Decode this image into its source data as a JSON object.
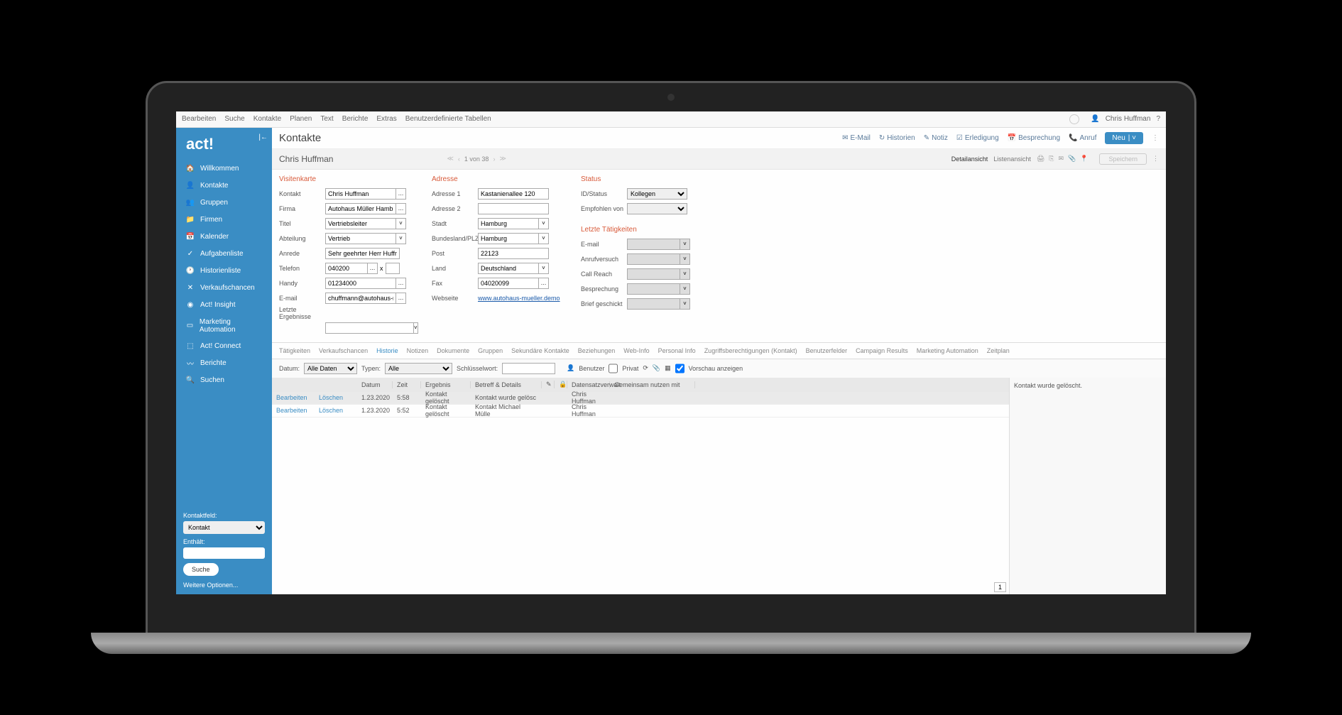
{
  "topmenu": [
    "Bearbeiten",
    "Suche",
    "Kontakte",
    "Planen",
    "Text",
    "Berichte",
    "Extras",
    "Benutzerdefinierte Tabellen"
  ],
  "user": "Chris Huffman",
  "logo": "act!",
  "nav": [
    {
      "icon": "🏠",
      "label": "Willkommen"
    },
    {
      "icon": "👤",
      "label": "Kontakte"
    },
    {
      "icon": "👥",
      "label": "Gruppen"
    },
    {
      "icon": "📁",
      "label": "Firmen"
    },
    {
      "icon": "📅",
      "label": "Kalender"
    },
    {
      "icon": "✓",
      "label": "Aufgabenliste"
    },
    {
      "icon": "🕐",
      "label": "Historienliste"
    },
    {
      "icon": "✕",
      "label": "Verkaufschancen"
    },
    {
      "icon": "◉",
      "label": "Act! Insight"
    },
    {
      "icon": "▭",
      "label": "Marketing Automation"
    },
    {
      "icon": "⬚",
      "label": "Act! Connect"
    },
    {
      "icon": "〰",
      "label": "Berichte"
    },
    {
      "icon": "🔍",
      "label": "Suchen"
    }
  ],
  "sidebar_bottom": {
    "kontaktfeld_label": "Kontaktfeld:",
    "kontaktfeld_value": "Kontakt",
    "enthaelt_label": "Enthält:",
    "enthaelt_value": "",
    "suche_btn": "Suche",
    "more": "Weitere Optionen..."
  },
  "page_title": "Kontakte",
  "header_actions": {
    "email": "E-Mail",
    "historien": "Historien",
    "notiz": "Notiz",
    "erledigung": "Erledigung",
    "besprechung": "Besprechung",
    "anruf": "Anruf",
    "neu": "Neu"
  },
  "contact_name": "Chris Huffman",
  "pager": {
    "text": "1 von 38"
  },
  "views": {
    "detail": "Detailansicht",
    "list": "Listenansicht"
  },
  "save": "Speichern",
  "sections": {
    "visitenkarte": "Visitenkarte",
    "adresse": "Adresse",
    "status": "Status",
    "letzte": "Letzte Tätigkeiten"
  },
  "visitenkarte": {
    "kontakt_l": "Kontakt",
    "kontakt_v": "Chris Huffman",
    "firma_l": "Firma",
    "firma_v": "Autohaus Müller Hamburg",
    "titel_l": "Titel",
    "titel_v": "Vertriebsleiter",
    "abteilung_l": "Abteilung",
    "abteilung_v": "Vertrieb",
    "anrede_l": "Anrede",
    "anrede_v": "Sehr geehrter Herr Huffman",
    "telefon_l": "Telefon",
    "telefon_v": "040200",
    "telefon_x": "x",
    "handy_l": "Handy",
    "handy_v": "01234000",
    "email_l": "E-mail",
    "email_v": "chuffmann@autohaus-mueller.d",
    "letzte_l": "Letzte Ergebnisse",
    "letzte_v": ""
  },
  "adresse": {
    "a1_l": "Adresse 1",
    "a1_v": "Kastanienallee 120",
    "a2_l": "Adresse 2",
    "a2_v": "",
    "stadt_l": "Stadt",
    "stadt_v": "Hamburg",
    "plz_l": "Bundesland/PLZ",
    "plz_v": "Hamburg",
    "post_l": "Post",
    "post_v": "22123",
    "land_l": "Land",
    "land_v": "Deutschland",
    "fax_l": "Fax",
    "fax_v": "04020099",
    "web_l": "Webseite",
    "web_v": "www.autohaus-mueller.demo"
  },
  "status": {
    "id_l": "ID/Status",
    "id_v": "Kollegen",
    "emp_l": "Empfohlen von",
    "emp_v": ""
  },
  "letzte": {
    "email_l": "E-mail",
    "anruf_l": "Anrufversuch",
    "call_l": "Call Reach",
    "besp_l": "Besprechung",
    "brief_l": "Brief geschickt"
  },
  "tabs": [
    "Tätigkeiten",
    "Verkaufschancen",
    "Historie",
    "Notizen",
    "Dokumente",
    "Gruppen",
    "Sekundäre Kontakte",
    "Beziehungen",
    "Web-Info",
    "Personal Info",
    "Zugriffsberechtigungen (Kontakt)",
    "Benutzerfelder",
    "Campaign Results",
    "Marketing Automation",
    "Zeitplan"
  ],
  "active_tab": 2,
  "filters": {
    "datum_l": "Datum:",
    "datum_v": "Alle Daten",
    "typen_l": "Typen:",
    "typen_v": "Alle",
    "key_l": "Schlüsselwort:",
    "key_v": "",
    "benutzer": "Benutzer",
    "privat": "Privat",
    "preview": "Vorschau anzeigen"
  },
  "grid": {
    "headers": [
      "",
      "",
      "Datum",
      "Zeit",
      "Ergebnis",
      "Betreff & Details",
      "",
      "",
      "Datensatzverwalt",
      "Gemeinsam nutzen mit"
    ],
    "rows": [
      {
        "edit": "Bearbeiten",
        "del": "Löschen",
        "datum": "1.23.2020",
        "zeit": "5:58",
        "erg": "Kontakt gelöscht",
        "betr": "Kontakt wurde gelösc",
        "verw": "Chris Huffman",
        "gem": ""
      },
      {
        "edit": "Bearbeiten",
        "del": "Löschen",
        "datum": "1.23.2020",
        "zeit": "5:52",
        "erg": "Kontakt gelöscht",
        "betr": "Kontakt Michael Mülle",
        "verw": "Chris Huffman",
        "gem": ""
      }
    ],
    "page": "1"
  },
  "preview_text": "Kontakt  wurde gelöscht."
}
